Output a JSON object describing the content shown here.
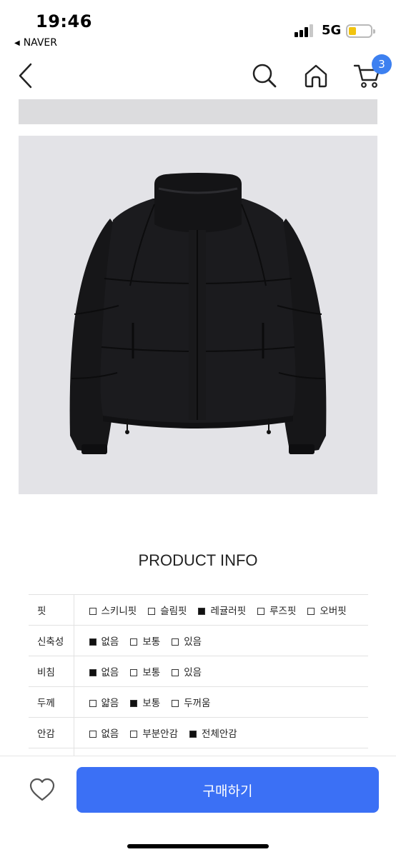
{
  "status_bar": {
    "time": "19:46",
    "back_app": "NAVER",
    "network": "5G",
    "battery_color": "#f2c40f"
  },
  "nav": {
    "back_icon": "chevron-left-icon",
    "search_icon": "search-icon",
    "home_icon": "home-icon",
    "cart_icon": "cart-icon",
    "cart_count": "3",
    "badge_color": "#3d80f0"
  },
  "product": {
    "image_main": "black-puffer-jacket-photo",
    "info_title": "PRODUCT INFO",
    "specs": [
      {
        "label": "핏",
        "options": [
          {
            "text": "스키니핏",
            "checked": false
          },
          {
            "text": "슬림핏",
            "checked": false
          },
          {
            "text": "레귤러핏",
            "checked": true
          },
          {
            "text": "루즈핏",
            "checked": false
          },
          {
            "text": "오버핏",
            "checked": false
          }
        ]
      },
      {
        "label": "신축성",
        "options": [
          {
            "text": "없음",
            "checked": true
          },
          {
            "text": "보통",
            "checked": false
          },
          {
            "text": "있음",
            "checked": false
          }
        ]
      },
      {
        "label": "비침",
        "options": [
          {
            "text": "없음",
            "checked": true
          },
          {
            "text": "보통",
            "checked": false
          },
          {
            "text": "있음",
            "checked": false
          }
        ]
      },
      {
        "label": "두께",
        "options": [
          {
            "text": "얇음",
            "checked": false
          },
          {
            "text": "보통",
            "checked": true
          },
          {
            "text": "두꺼움",
            "checked": false
          }
        ]
      },
      {
        "label": "안감",
        "options": [
          {
            "text": "없음",
            "checked": false
          },
          {
            "text": "부분안감",
            "checked": false
          },
          {
            "text": "전체안감",
            "checked": true
          }
        ]
      }
    ]
  },
  "bottom_bar": {
    "wishlist_icon": "heart-icon",
    "buy_label": "구매하기",
    "buy_color": "#3b70f5"
  }
}
